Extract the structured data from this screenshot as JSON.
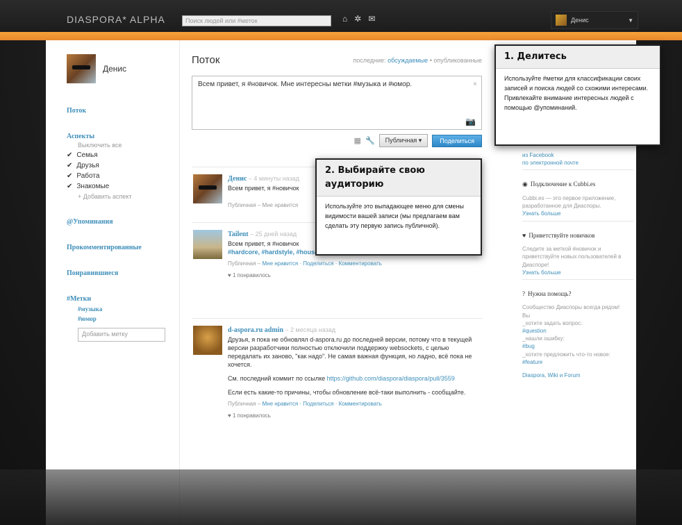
{
  "topbar": {
    "brand": "DIASPORA* ALPHA",
    "search_placeholder": "Поиск людей или #меток",
    "user_name": "Денис",
    "icons": [
      "home-icon",
      "network-icon",
      "mail-icon"
    ]
  },
  "sidebar": {
    "user_name": "Денис",
    "stream": "Поток",
    "aspects": "Аспекты",
    "select_all": "Выключить все",
    "aspect_items": [
      "Семья",
      "Друзья",
      "Работа",
      "Знакомые"
    ],
    "add_aspect": "+ Добавить аспект",
    "mentions": "@Упоминания",
    "commented": "Прокомментированные",
    "liked": "Понравившиеся",
    "tags_title": "#Метки",
    "tags": [
      "#музыка",
      "#юмор"
    ],
    "add_tag_placeholder": "Добавить метку"
  },
  "stream": {
    "title": "Поток",
    "sort_prefix": "последние:",
    "sort_active": "обсуждаемые",
    "sort_other": "• опубликованные",
    "composer_text": "Всем привет, я #новичок. Мне интересны метки #музыка и #юмор.",
    "visibility_button": "Публичная ▾",
    "share_button": "Поделиться"
  },
  "posts": [
    {
      "author": "Денис",
      "meta": "– 4 минуты назад",
      "text": "Всем привет, я #новичок",
      "actions": "Публичная – Мне нравится"
    },
    {
      "author": "Tailent",
      "meta": "– 25 дней назад",
      "text": "Всем привет, я #новичок",
      "tags": "#hardcore, #hardstyle, #house, #music",
      "actions_prefix": "Публичная –",
      "actions_links": "Мне нравится · Поделиться · Комментировать",
      "likes": "1 понравилось"
    },
    {
      "author": "d-aspora.ru admin",
      "meta": "– 2 месяца назад",
      "text": "Друзья, я пока не обновлял d-aspora.ru до последней версии, потому что в текущей версии разработчики полностью отключили поддержку websockets, с целью передалать их заново, \"как надо\". Не самая важная функция, но ладно, всё пока не хочется.",
      "text2_prefix": "См. последний коммит по ссылке",
      "text2_link": "https://github.com/diaspora/diaspora/pull/3559",
      "text3": "Если есть какие-то причины, чтобы обновление всё-таки выполнить - сообщайте.",
      "actions_prefix": "Публичная –",
      "actions_links": "Мне нравится · Поделиться · Комментировать",
      "likes": "1 понравилось"
    }
  ],
  "right": {
    "link1": "из Facebook",
    "link2": "по электронной почте",
    "connect_title": "Подключение к Cubbi.es",
    "connect_text": "Cubbi.es — это первое приложение, разработанное для Диаспоры.",
    "connect_link": "Узнать больше",
    "welcome_title": "Приветствуйте новичков",
    "welcome_text": "Следите за меткой #новичок и приветствуйте новых пользователей в Диаспоре!",
    "welcome_link": "Узнать больше",
    "help_title": "Нужна помощь?",
    "help_text": "Сообщество Диаспоры всегда рядом!",
    "help_line1": "Вы",
    "help_line2": "_хотите задать вопрос:",
    "help_tag1": "#question",
    "help_line3": "_нашли ошибку:",
    "help_tag2": "#bug",
    "help_line4": "_хотите предложить что-то новое:",
    "help_tag3": "#feature",
    "wiki": "Diaspora, Wiki и Forum"
  },
  "tooltips": {
    "t1_title": "1. Делитесь",
    "t1_body": "Используйте #метки для классификации своих записей и поиска людей со схожими интересами. Привлекайте внимание интересных людей с помощью @упоминаний.",
    "t2_title": "2. Выбирайте свою аудиторию",
    "t2_body": "Используйте это выпадающее меню для смены видимости вашей записи (мы предлагаем вам сделать эту первую запись публичной)."
  }
}
